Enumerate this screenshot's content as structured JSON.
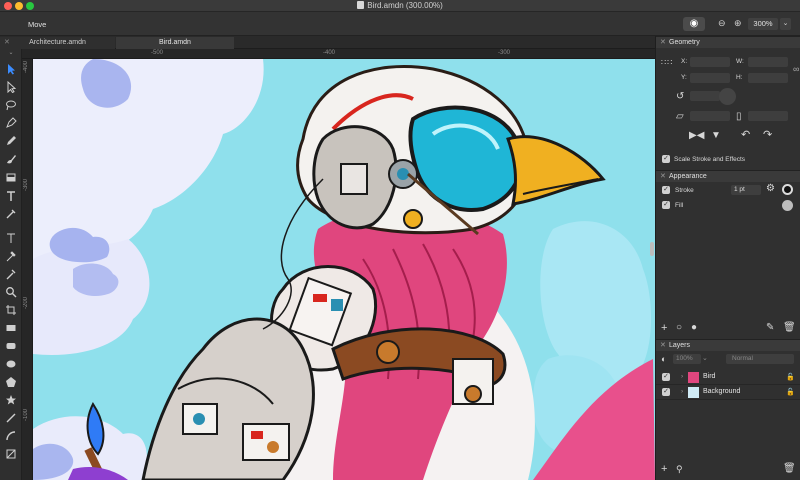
{
  "window": {
    "title": "Bird.amdn (300.00%)"
  },
  "toolbar": {
    "tool_name": "Move",
    "zoom_value": "300%",
    "zoom_out_icon": "zoom-out-icon",
    "zoom_in_icon": "zoom-in-icon",
    "view_icon": "eye-icon"
  },
  "tabs": [
    {
      "label": "Architecture.amdn",
      "active": false
    },
    {
      "label": "Bird.amdn",
      "active": true
    }
  ],
  "rulers": {
    "top": [
      "-500",
      "-400",
      "-300"
    ],
    "left": [
      "-400",
      "-300",
      "-200",
      "-100"
    ]
  },
  "tools": [
    "move-tool-icon",
    "node-tool-icon",
    "lasso-icon",
    "pen-icon",
    "pencil-icon",
    "brush-icon",
    "fill-tool-icon",
    "text-icon",
    "eyedropper-icon",
    "text-path-icon",
    "color-picker-icon",
    "zoom-icon",
    "crop-icon",
    "rectangle-icon",
    "rounded-rectangle-icon",
    "ellipse-icon",
    "polygon-icon",
    "star-icon",
    "line-icon",
    "arc-icon",
    "frame-icon"
  ],
  "geometry": {
    "title": "Geometry",
    "x_label": "X:",
    "y_label": "Y:",
    "w_label": "W:",
    "h_label": "H:",
    "scale_stroke_label": "Scale Stroke and Effects",
    "scale_stroke_checked": true
  },
  "appearance": {
    "title": "Appearance",
    "stroke_label": "Stroke",
    "stroke_value": "1 pt",
    "stroke_checked": true,
    "fill_label": "Fill",
    "fill_checked": true,
    "stroke_color": "#111111",
    "fill_color": "#bdbdbd"
  },
  "layers": {
    "title": "Layers",
    "opacity": "100%",
    "blend_mode": "Normal",
    "items": [
      {
        "name": "Bird",
        "visible": true
      },
      {
        "name": "Background",
        "visible": true
      }
    ]
  },
  "colors": {
    "accent": "#2f7bf6",
    "canvas_bg": "#8fe0ec"
  }
}
